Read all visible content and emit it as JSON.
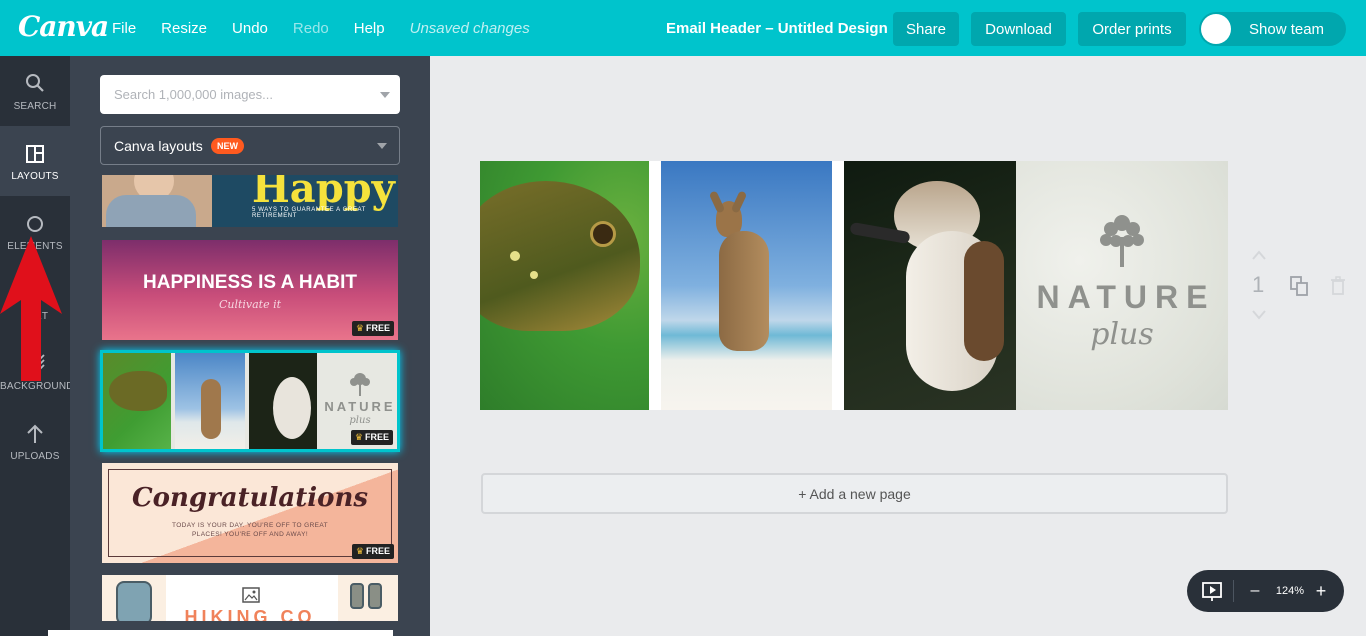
{
  "app": {
    "logo": "Canva"
  },
  "menu": {
    "file": "File",
    "resize": "Resize",
    "undo": "Undo",
    "redo": "Redo",
    "help": "Help",
    "status": "Unsaved changes"
  },
  "design_title": "Email Header – Untitled Design",
  "buttons": {
    "share": "Share",
    "download": "Download",
    "order_prints": "Order prints",
    "show_team": "Show team"
  },
  "nav": {
    "search": "SEARCH",
    "layouts": "LAYOUTS",
    "elements": "ELEMENTS",
    "text": "TEXT",
    "background": "BACKGROUND",
    "uploads": "UPLOADS"
  },
  "panel": {
    "search_placeholder": "Search 1,000,000 images...",
    "category": "Canva layouts",
    "category_badge": "NEW"
  },
  "layouts": [
    {
      "title": "Happy",
      "subtitle": "5 WAYS TO GUARANTEE A GREAT RETIREMENT"
    },
    {
      "title": "HAPPINESS IS A HABIT",
      "subtitle": "Cultivate it",
      "badge": "FREE"
    },
    {
      "title": "NATURE",
      "subtitle": "plus",
      "badge": "FREE"
    },
    {
      "title": "Congratulations",
      "line1": "TODAY IS YOUR DAY. YOU'RE OFF TO GREAT",
      "line2": "PLACES! YOU'RE OFF AND AWAY!",
      "badge": "FREE"
    },
    {
      "title": "HIKING CO"
    }
  ],
  "canvas": {
    "brand_title": "NATURE",
    "brand_sub": "plus",
    "page_number": "1",
    "add_page": "+ Add a new page"
  },
  "zoom": {
    "minus": "–",
    "level": "124%",
    "plus": "+"
  },
  "colors": {
    "brand": "#00c4cc",
    "button": "#00a7ae",
    "sidebar": "#293039",
    "panel": "#3b4450",
    "badge": "#ff5a1f",
    "arrow": "#e0101b"
  }
}
